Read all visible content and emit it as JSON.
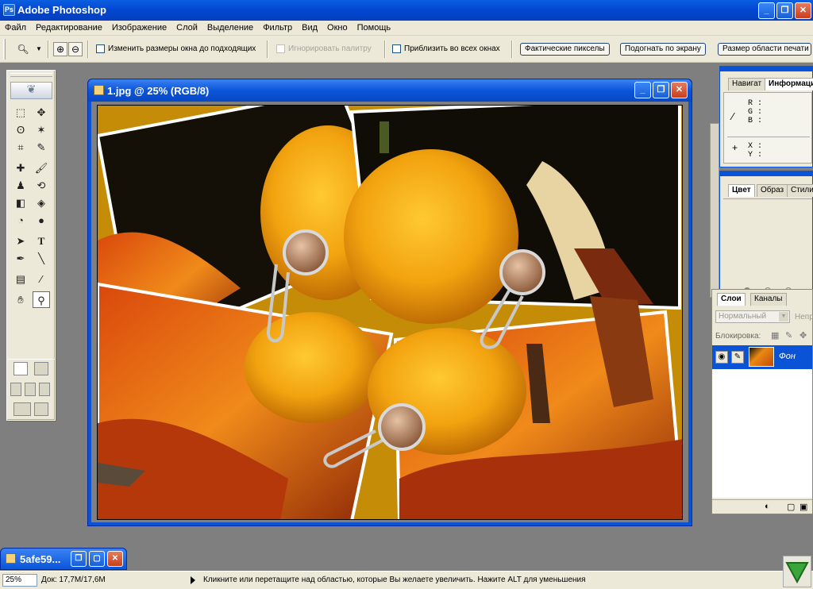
{
  "app": {
    "title": "Adobe Photoshop",
    "icon": "photoshop-icon",
    "accent": "#0a52d6"
  },
  "window_controls": {
    "minimize": "_",
    "restore": "❐",
    "close": "✕"
  },
  "menubar": {
    "items": [
      "Файл",
      "Редактирование",
      "Изображение",
      "Слой",
      "Выделение",
      "Фильтр",
      "Вид",
      "Окно",
      "Помощь"
    ]
  },
  "options": {
    "resize_windows": "Изменить размеры окна до подходящих",
    "ignore_palettes": "Игнорировать палитру",
    "zoom_all_windows": "Приблизить во всех окнах",
    "actual_pixels": "Фактические пикселы",
    "fit_screen": "Подогнать по экрану",
    "print_size": "Размер области печати"
  },
  "document": {
    "title": "1.jpg @ 25% (RGB/8)",
    "background_color": "#c58c08"
  },
  "info_panel": {
    "tabs": [
      "Навигат",
      "Информация"
    ],
    "rgb": [
      "R :",
      "G :",
      "B :"
    ],
    "xy": [
      "X :",
      "Y :"
    ]
  },
  "color_panel": {
    "tabs": [
      "Цвет",
      "Образ",
      "Стили"
    ]
  },
  "layers_panel": {
    "tabs": [
      "Слои",
      "Каналы"
    ],
    "blend_mode": "Нормальный",
    "opacity_label": "Непр",
    "lock_label": "Блокировка:",
    "layer_name": "Фон"
  },
  "colors": {
    "foreground": "#c58c08",
    "background": "#ffffff"
  },
  "minimized": {
    "title": "5afe59..."
  },
  "status": {
    "zoom": "25%",
    "doc_size": "Док: 17,7M/17,6M",
    "tip": "Кликните или перетащите над областью, которые Вы желаете увеличить. Нажите ALT для уменьшения"
  }
}
